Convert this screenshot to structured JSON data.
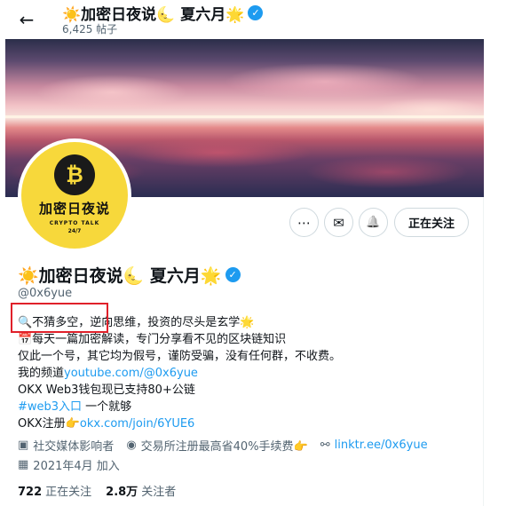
{
  "header": {
    "title": "☀️加密日夜说🌜 夏六月🌟",
    "posts_count": "6,425 帖子"
  },
  "avatar": {
    "coin_symbol": "₿",
    "text": "加密日夜说",
    "sub1": "CRYPTO TALK",
    "sub2": "24/7"
  },
  "actions": {
    "more": "⋯",
    "message": "✉",
    "notify": "🔔",
    "follow_label": "正在关注"
  },
  "profile": {
    "name": "☀️加密日夜说🌜 夏六月🌟",
    "handle": "@0x6yue"
  },
  "bio": {
    "l1_icon": "🔍",
    "l1_text": "不猜多空，逆向思维，投资的尽头是玄学🌟",
    "l2": "📅每天一篇加密解读，专门分享看不见的区块链知识",
    "l3": "仅此一个号，其它均为假号，谨防受骗，没有任何群，不收费。",
    "l4_prefix": "我的频道",
    "l4_link": "youtube.com/@0x6yue",
    "l5": "OKX Web3钱包现已支持80+公链",
    "l6_tag": "#web3入口",
    "l6_rest": " 一个就够",
    "l7_prefix": "OKX注册👉",
    "l7_link": "okx.com/join/6YUE6"
  },
  "meta": {
    "category": "社交媒体影响者",
    "location": "交易所注册最高省40%手续费👉",
    "website": "linktr.ee/0x6yue",
    "joined": "2021年4月 加入"
  },
  "stats": {
    "following_count": "722",
    "following_label": "正在关注",
    "followers_count": "2.8万",
    "followers_label": "关注者"
  },
  "icons": {
    "back": "arrow-left-icon",
    "verified": "verified-badge-icon",
    "category": "briefcase-icon",
    "location": "location-pin-icon",
    "website": "link-icon",
    "joined": "calendar-icon"
  },
  "colors": {
    "accent": "#1d9bf0",
    "highlight_box": "#e0202a",
    "avatar_bg": "#f7d83b"
  }
}
